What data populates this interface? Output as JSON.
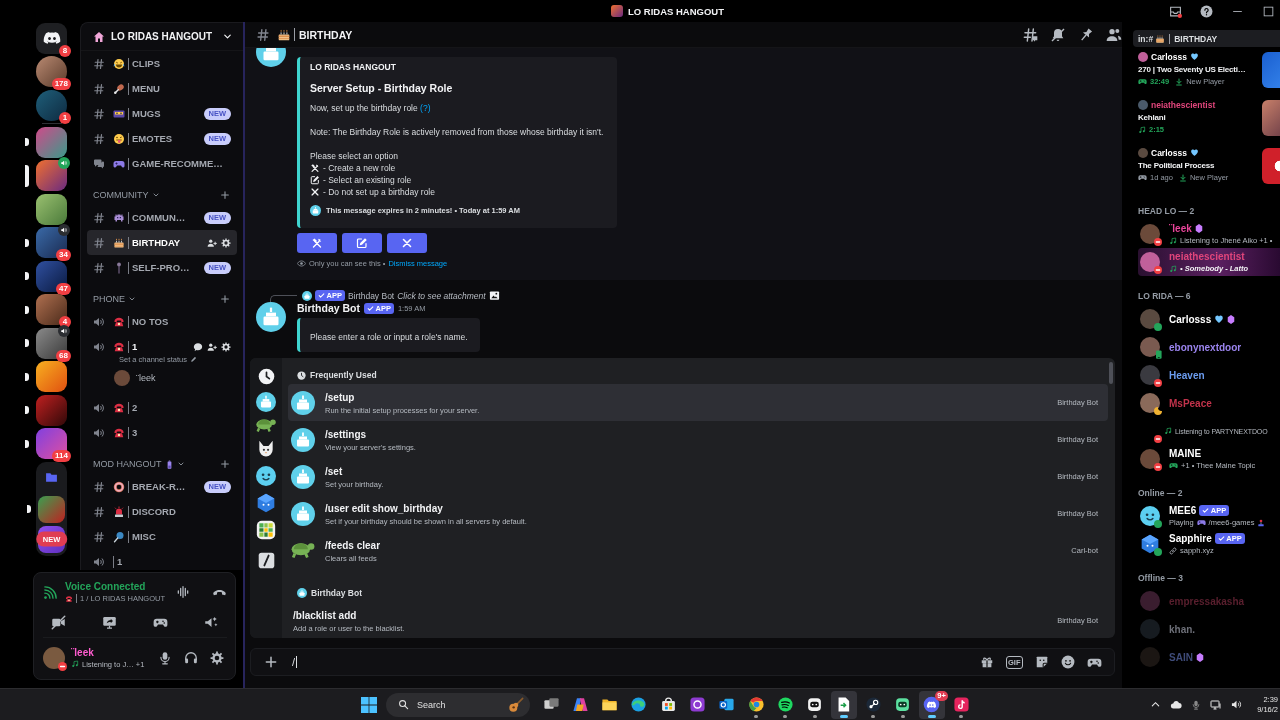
{
  "title_bar": {
    "title": "LO RIDAS HANGOUT"
  },
  "servers": [
    {
      "kind": "home",
      "badge": "8",
      "selected": false,
      "unread": false
    },
    {
      "kind": "dm",
      "badge": "178",
      "selected": false,
      "unread": false
    },
    {
      "kind": "dm",
      "badge": "1",
      "selected": false,
      "unread": false
    },
    {
      "kind": "server",
      "selected": false,
      "unread": true
    },
    {
      "kind": "server",
      "selected": true,
      "voice": {
        "kind": "connected"
      }
    },
    {
      "kind": "server",
      "selected": false,
      "unread": false
    },
    {
      "kind": "server",
      "badge": "34",
      "selected": false,
      "unread": true,
      "voice": {
        "kind": "active"
      }
    },
    {
      "kind": "server",
      "badge": "47",
      "selected": false,
      "unread": true
    },
    {
      "kind": "server",
      "badge": "4",
      "selected": false,
      "unread": true
    },
    {
      "kind": "server",
      "badge": "68",
      "selected": false,
      "unread": true,
      "voice": {
        "kind": "active"
      }
    },
    {
      "kind": "server",
      "selected": false,
      "unread": true
    },
    {
      "kind": "server",
      "selected": false,
      "unread": true
    },
    {
      "kind": "server",
      "badge": "114",
      "selected": false,
      "unread": true
    },
    {
      "kind": "folder",
      "expanded": true,
      "selected": false,
      "unread": false,
      "children": [
        {
          "kind": "server",
          "selected": false,
          "unread": true
        },
        {
          "kind": "server",
          "selected": false,
          "unread": false,
          "notice": "NEW"
        }
      ]
    }
  ],
  "sidebar": {
    "server_name": "LO RIDAS HANGOUT",
    "groups": [
      {
        "channels": [
          {
            "kind": "text",
            "name": "CLIPS",
            "selected": false
          },
          {
            "kind": "text",
            "name": "MENU",
            "selected": false
          },
          {
            "kind": "text",
            "name": "MUGS",
            "badge": "NEW",
            "selected": false
          },
          {
            "kind": "text",
            "name": "EMOTES",
            "badge": "NEW",
            "selected": false
          },
          {
            "kind": "forum",
            "name": "GAME-RECOMME…",
            "selected": false
          }
        ]
      },
      {
        "category": "COMMUNITY",
        "channels": [
          {
            "kind": "text",
            "name": "COMMUN…",
            "badge": "NEW",
            "selected": false
          },
          {
            "kind": "text",
            "name": "BIRTHDAY",
            "selected": true
          },
          {
            "kind": "text",
            "name": "SELF-PRO…",
            "badge": "NEW",
            "selected": false
          }
        ]
      },
      {
        "category": "PHONE",
        "channels": [
          {
            "kind": "voice",
            "name": "NO TOS",
            "selected": false,
            "connected": false
          },
          {
            "kind": "voice",
            "name": "1",
            "selected": false,
            "connected": true,
            "status": "Set a channel status",
            "members": [
              {
                "name": "¨leek"
              }
            ]
          },
          {
            "kind": "voice",
            "name": "2",
            "selected": false,
            "connected": false
          },
          {
            "kind": "voice",
            "name": "3",
            "selected": false,
            "connected": false
          }
        ]
      },
      {
        "category": "MOD HANGOUT",
        "channels": [
          {
            "kind": "text",
            "name": "BREAK-R…",
            "badge": "NEW",
            "selected": false
          },
          {
            "kind": "text",
            "name": "DISCORD",
            "selected": false
          },
          {
            "kind": "text",
            "name": "MISC",
            "selected": false
          },
          {
            "kind": "voice",
            "name": "1",
            "selected": false,
            "connected": false
          }
        ]
      }
    ]
  },
  "voice_panel": {
    "status": "Voice Connected",
    "channel": "1 / LO RIDAS HANGOUT"
  },
  "user_panel": {
    "name": "¨leek",
    "activity": "Listening to J… +1",
    "status": {
      "kind": "dnd",
      "color": "#f23f43"
    }
  },
  "chat_header": {
    "channel": "BIRTHDAY"
  },
  "search": {
    "scope": "in:#",
    "channel": "BIRTHDAY"
  },
  "messages": [
    {
      "kind": "ephemeral",
      "embed": {
        "author": "LO RIDAS HANGOUT",
        "title": "Server Setup - Birthday Role",
        "description": "Now, set up the birthday role",
        "help_link": "(?)",
        "note": "Note: The Birthday Role is actively removed from those whose birthday it isn't.",
        "prompt": "Please select an option",
        "options": [
          "- Create a new role",
          "- Select an existing role",
          "- Do not set up a birthday role"
        ],
        "footer": "This message expires in 2 minutes! • Today at 1:59 AM"
      },
      "notice": "Only you can see this •",
      "dismiss": "Dismiss message"
    },
    {
      "kind": "reply",
      "reply": {
        "tag": "APP",
        "author": "Birthday Bot",
        "text": "Click to see attachment"
      },
      "author": "Birthday Bot",
      "tag": "APP",
      "time": "1:59 AM",
      "embed": {
        "description": "Please enter a role or input a role's name."
      }
    }
  ],
  "command_popup": {
    "sections": [
      {
        "kind": "recent",
        "title": "Frequently Used",
        "commands": [
          {
            "name": "/setup",
            "description": "Run the initial setup processes for your server.",
            "app": "Birthday Bot",
            "selected": true
          },
          {
            "name": "/settings",
            "description": "View your server's settings.",
            "app": "Birthday Bot",
            "selected": false
          },
          {
            "name": "/set",
            "description": "Set your birthday.",
            "app": "Birthday Bot",
            "selected": false
          },
          {
            "name": "/user edit show_birthday",
            "description": "Set if your birthday should be shown in all servers by default.",
            "app": "Birthday Bot",
            "selected": false
          },
          {
            "name": "/feeds clear",
            "description": "Clears all feeds",
            "app": "Carl-bot",
            "selected": false
          }
        ]
      },
      {
        "kind": "app",
        "title": "Birthday Bot",
        "commands": [
          {
            "name": "/blacklist add",
            "description": "Add a role or user to the blacklist.",
            "app": "Birthday Bot",
            "selected": false
          }
        ]
      }
    ]
  },
  "composer": {
    "value": "/",
    "gif_label": "GIF"
  },
  "member_list": {
    "activities": [
      {
        "kind": "game",
        "live": true,
        "name": "Carlosss",
        "color": "#ffffff",
        "name_emoji": true,
        "title": "270 | Two Seventy US Electi…",
        "time": "32:49",
        "extra": "New Player"
      },
      {
        "kind": "music",
        "live": true,
        "name": "neiathescientist",
        "color": "#e0457b",
        "title": "Kehlani",
        "time": "2:15"
      },
      {
        "kind": "game",
        "live": false,
        "name": "Carlosss",
        "color": "#ffffff",
        "name_emoji": true,
        "title": "The Political Process",
        "time": "1d ago",
        "extra": "New Player"
      }
    ],
    "groups": [
      {
        "title": "HEAD LO — 2",
        "members": [
          {
            "name": "¨leek",
            "color": "#e8459a",
            "status": {
              "kind": "dnd",
              "color": "#f23f43"
            },
            "boosting": true,
            "activity": {
              "kind": "music",
              "text": "Listening to Jhené Aiko +1 •"
            }
          },
          {
            "name": "neiathescientist",
            "color": "#e0457b",
            "status": {
              "kind": "dnd",
              "color": "#f23f43"
            },
            "banner": true,
            "activity": {
              "kind": "music",
              "text": "• Somebody - Latto"
            }
          }
        ]
      },
      {
        "title": "LO RIDA — 6",
        "members": [
          {
            "name": "Carlosss",
            "color": "#ffffff",
            "status": {
              "kind": "online",
              "color": "#23a55a"
            },
            "name_emoji": true,
            "boosting": true
          },
          {
            "name": "ebonynextdoor",
            "color": "#9b84ee",
            "status": {
              "kind": "mobile",
              "color": "#23a55a"
            }
          },
          {
            "name": "Heaven",
            "color": "#6b9cf0",
            "status": {
              "kind": "dnd",
              "color": "#f23f43"
            }
          },
          {
            "name": "MsPeace",
            "color": "#c2334b",
            "status": {
              "kind": "idle",
              "color": "#f0b232"
            }
          },
          {
            "status": {
              "kind": "dnd",
              "color": "#f23f43"
            },
            "activity": {
              "kind": "music",
              "text": "Listening to PARTYNEXTDOO"
            }
          },
          {
            "name": "MAINE",
            "color": "#ffffff",
            "status": {
              "kind": "dnd",
              "color": "#f23f43"
            },
            "activity": {
              "kind": "game",
              "text": "+1 • Thee Maine Topic"
            }
          }
        ]
      },
      {
        "title": "Online — 2",
        "members": [
          {
            "name": "MEE6",
            "color": "#ffffff",
            "tag": "APP",
            "status": {
              "kind": "online",
              "color": "#23a55a"
            },
            "activity": {
              "kind": "game",
              "text": "Playing",
              "detail": "/mee6-games"
            }
          },
          {
            "name": "Sapphire",
            "color": "#ffffff",
            "tag": "APP",
            "status": {
              "kind": "online",
              "color": "#23a55a"
            },
            "activity": {
              "kind": "link",
              "text": "sapph.xyz"
            }
          }
        ]
      },
      {
        "title": "Offline — 3",
        "members": [
          {
            "name": "empressakasha",
            "color": "#5a1f2e",
            "status": {
              "kind": "offline"
            }
          },
          {
            "name": "khan.",
            "color": "#6d6f78",
            "status": {
              "kind": "offline"
            }
          },
          {
            "name": "SAIN",
            "color": "#3f4c7a",
            "status": {
              "kind": "offline"
            },
            "boosting": true
          }
        ]
      }
    ]
  },
  "taskbar": {
    "search": "Search",
    "apps": [
      {
        "running": false,
        "active": false
      },
      {
        "running": false,
        "active": false
      },
      {
        "running": false,
        "active": false
      },
      {
        "running": false,
        "active": false
      },
      {
        "running": false,
        "active": false
      },
      {
        "running": false,
        "active": false
      },
      {
        "running": false,
        "active": false
      },
      {
        "running": true,
        "active": false
      },
      {
        "running": true,
        "active": false
      },
      {
        "running": true,
        "active": false
      },
      {
        "running": true,
        "active": true
      },
      {
        "running": true,
        "active": false
      },
      {
        "running": true,
        "active": false
      },
      {
        "running": true,
        "active": true,
        "badge": "9+"
      },
      {
        "running": true,
        "active": false
      }
    ],
    "time": "2:39",
    "date": "9/16/2"
  }
}
